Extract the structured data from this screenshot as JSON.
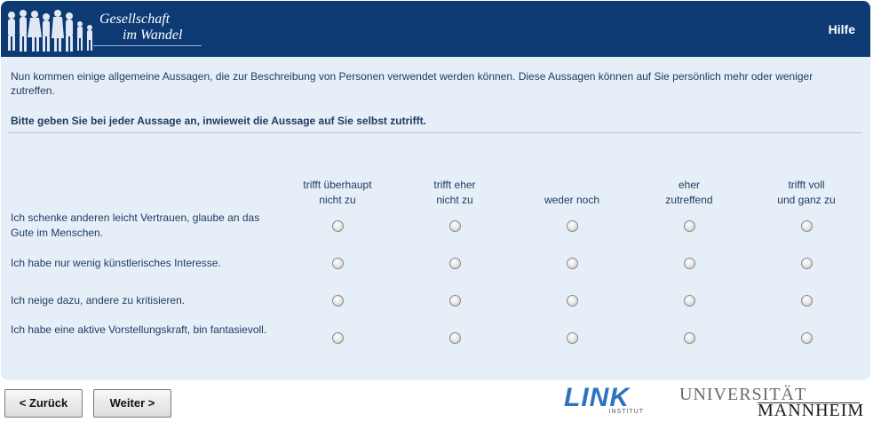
{
  "header": {
    "logo_line1": "Gesellschaft",
    "logo_line2": "im Wandel",
    "help_label": "Hilfe"
  },
  "intro": {
    "text": "Nun kommen einige allgemeine Aussagen, die zur Beschreibung von Personen verwendet werden können. Diese Aussagen können auf Sie persönlich mehr oder weniger zutreffen.",
    "instruction": "Bitte geben Sie bei jeder Aussage an, inwieweit die Aussage auf Sie selbst zutrifft."
  },
  "scale": [
    {
      "line1": "trifft überhaupt",
      "line2": "nicht zu"
    },
    {
      "line1": "trifft eher",
      "line2": "nicht zu"
    },
    {
      "line1": "",
      "line2": "weder noch"
    },
    {
      "line1": "eher",
      "line2": "zutreffend"
    },
    {
      "line1": "trifft voll",
      "line2": "und ganz zu"
    }
  ],
  "items": [
    {
      "label": "Ich schenke anderen leicht Vertrauen, glaube an das Gute im Menschen.",
      "selected": null
    },
    {
      "label": "Ich habe nur wenig künstlerisches Interesse.",
      "selected": null
    },
    {
      "label": "Ich neige dazu, andere zu kritisieren.",
      "selected": null
    },
    {
      "label": "Ich habe eine aktive Vorstellungskraft, bin fantasievoll.",
      "selected": null
    }
  ],
  "nav": {
    "back_label": "< Zurück",
    "next_label": "Weiter >"
  },
  "footer": {
    "link_logo": "LINK",
    "link_sub": "INSTITUT",
    "uni_line1": "UNIVERSITÄT",
    "uni_line2": "MANNHEIM"
  },
  "colors": {
    "header_bg": "#0d3a73",
    "panel_bg": "#e6eef8",
    "text": "#1e3a5f",
    "link_blue": "#2e73c2"
  }
}
